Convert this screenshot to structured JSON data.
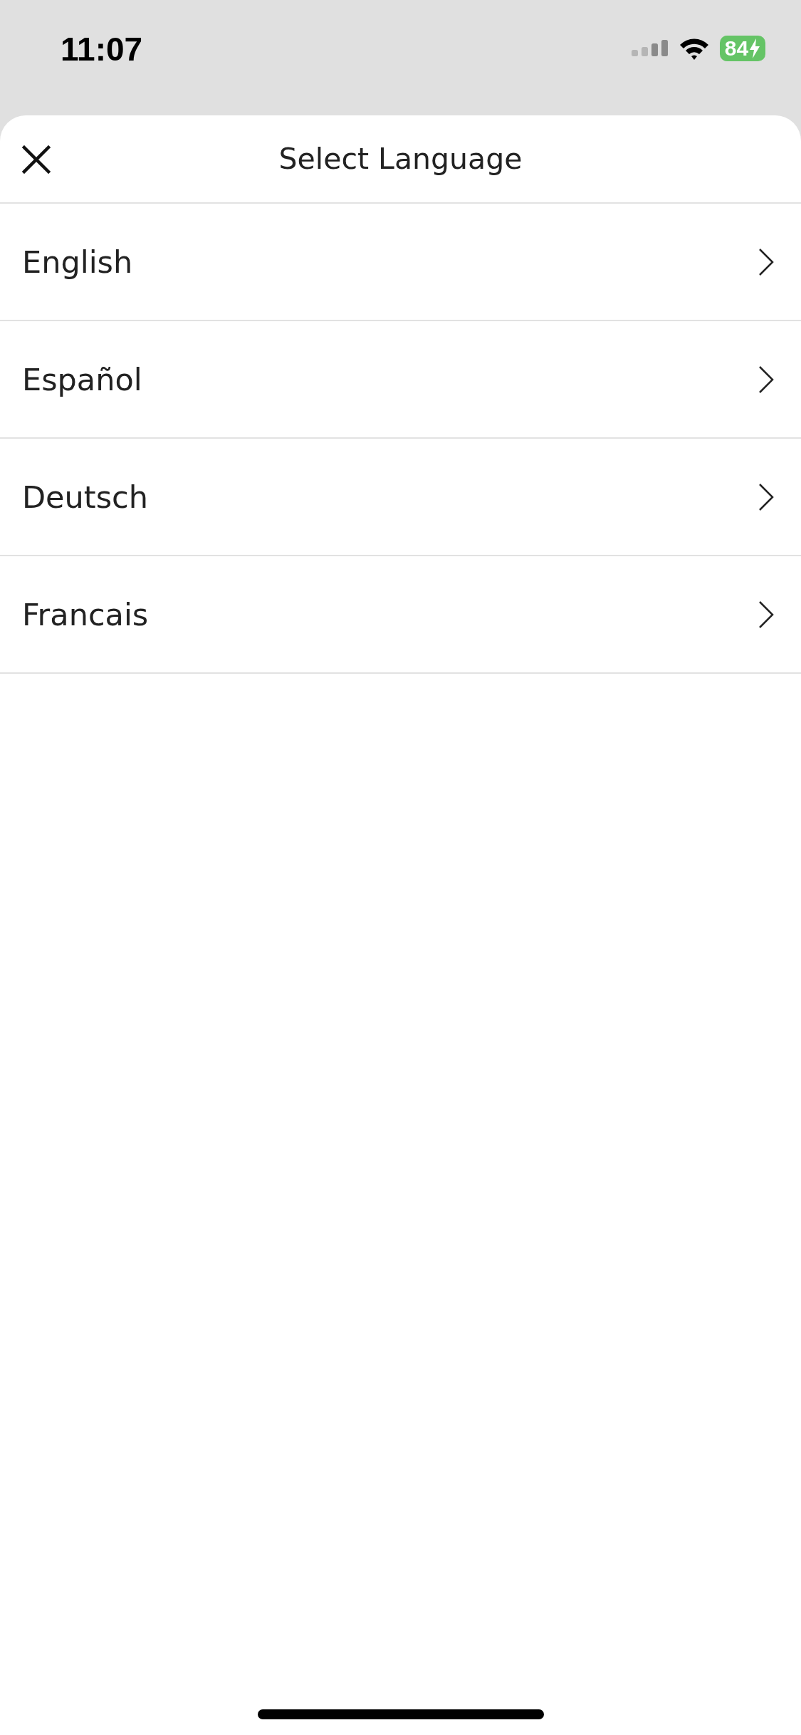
{
  "status_bar": {
    "time": "11:07",
    "battery": "84"
  },
  "header": {
    "title": "Select Language"
  },
  "languages": [
    {
      "label": "English"
    },
    {
      "label": "Español"
    },
    {
      "label": "Deutsch"
    },
    {
      "label": "Francais"
    }
  ]
}
